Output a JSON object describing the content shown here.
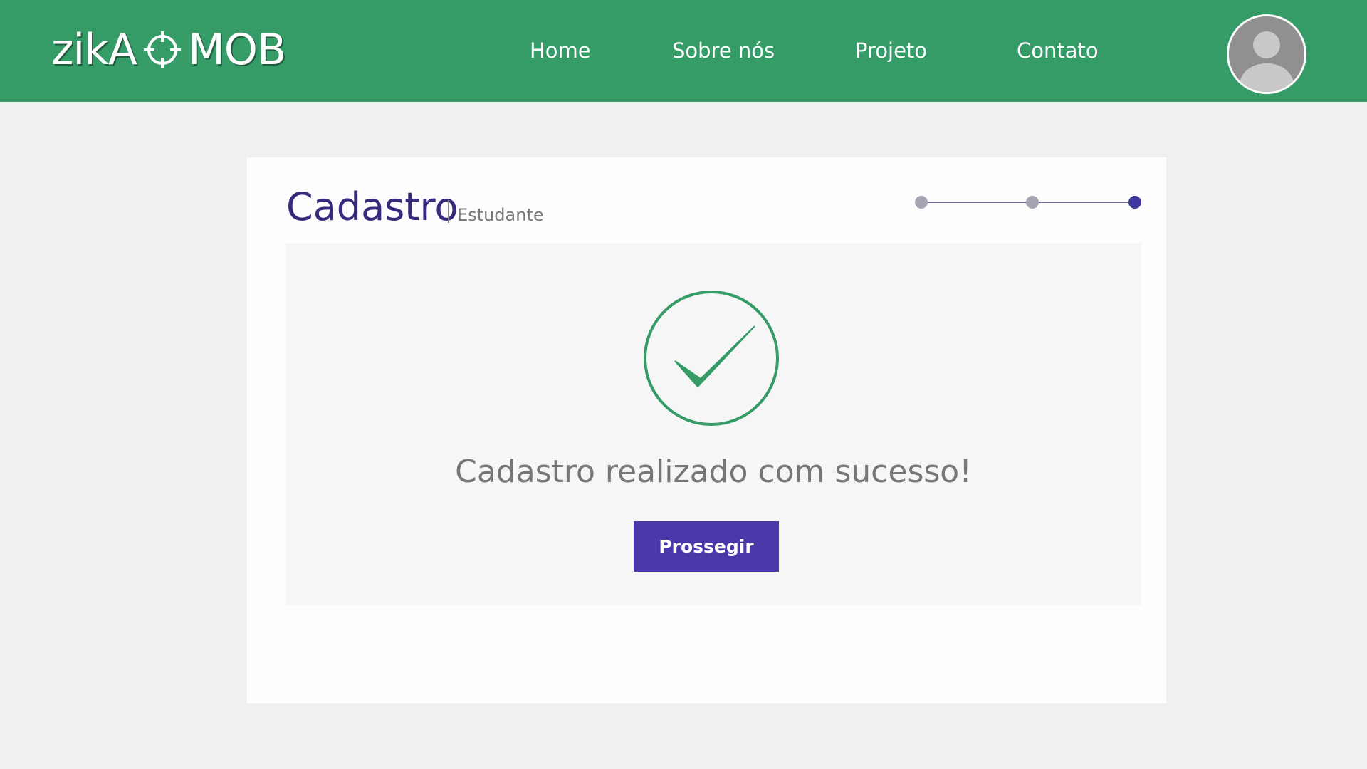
{
  "header": {
    "brand": {
      "left": "zikA",
      "right": "MOB"
    },
    "nav": [
      {
        "label": "Home"
      },
      {
        "label": "Sobre nós"
      },
      {
        "label": "Projeto"
      },
      {
        "label": "Contato"
      }
    ],
    "avatar_icon": "user-avatar-icon"
  },
  "card": {
    "title": "Cadastro",
    "subtitle": "Estudante",
    "stepper": {
      "total_steps": 3,
      "current_step": 3
    },
    "success_icon": "check-circle-icon",
    "message": "Cadastro realizado com sucesso!",
    "button_label": "Prossegir"
  },
  "colors": {
    "header_bg": "#359b67",
    "page_bg": "#f0f0f0",
    "title": "#352a7c",
    "accent": "#4a38a9",
    "success": "#359b67",
    "step_inactive": "#a6a4b3",
    "step_active": "#4036a0"
  }
}
